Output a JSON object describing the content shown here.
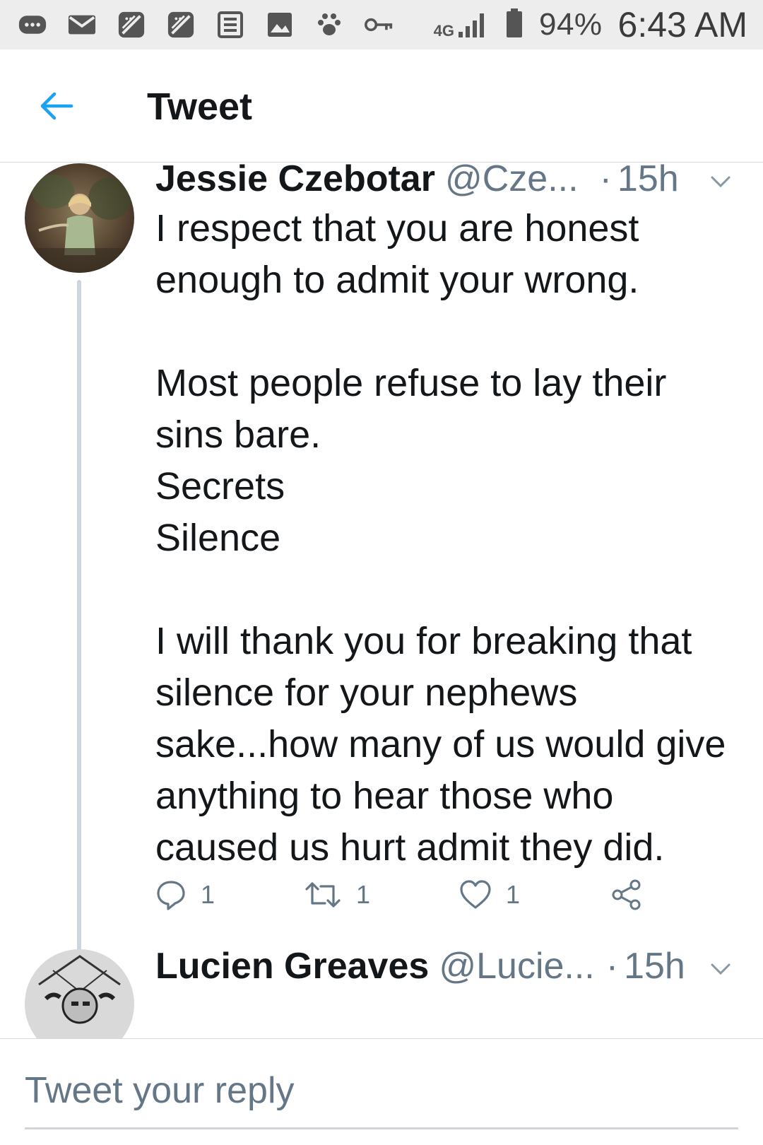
{
  "status_bar": {
    "battery": "94%",
    "time": "6:43 AM",
    "network": "4G"
  },
  "header": {
    "title": "Tweet"
  },
  "tweets": [
    {
      "name": "Jessie Czebotar",
      "handle": "@Cze...",
      "dot": "·",
      "time": "15h",
      "paragraphs": [
        "I respect that you are honest enough to admit your wrong.",
        "Most people refuse to lay their sins bare.\nSecrets\nSilence",
        "I will thank you for breaking that silence for your nephews sake...how many of us would give anything to hear those who caused us hurt admit they did."
      ],
      "reply_count": "1",
      "retweet_count": "1",
      "like_count": "1"
    },
    {
      "name": "Lucien Greaves",
      "handle": "@Lucie...",
      "dot": "·",
      "time": "15h"
    }
  ],
  "reply": {
    "placeholder": "Tweet your reply"
  },
  "colors": {
    "accent": "#1da1f2",
    "secondary_text": "#657786",
    "thread_line": "#cdd6dd"
  }
}
